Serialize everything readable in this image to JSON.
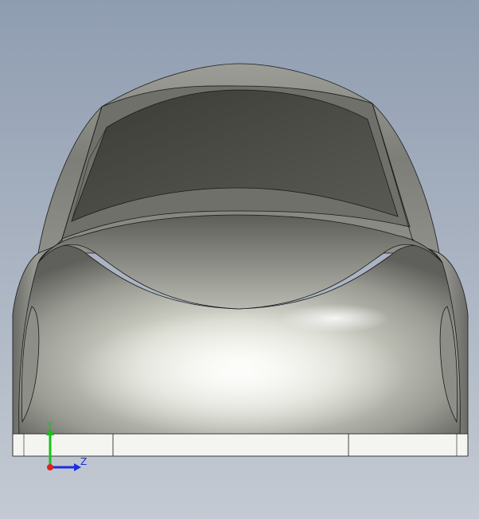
{
  "viewport": {
    "axes": {
      "y_label": "Y",
      "z_label": "Z"
    },
    "colors": {
      "y_axis": "#19c019",
      "z_axis": "#1e2de0",
      "origin": "#e02020",
      "outline": "#1a1a1a"
    }
  }
}
